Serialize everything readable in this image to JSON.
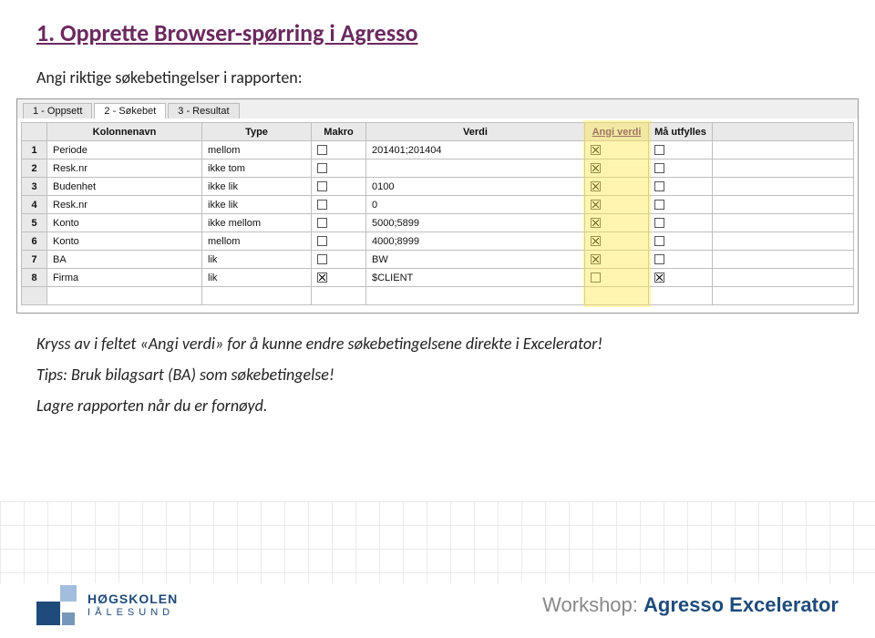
{
  "title": "1. Opprette Browser-spørring i Agresso",
  "intro": "Angi riktige søkebetingelser i rapporten:",
  "tabs": {
    "t1": "1 - Oppsett",
    "t2": "2 - Søkebet",
    "t3": "3 - Resultat"
  },
  "headers": {
    "kol": "Kolonnenavn",
    "type": "Type",
    "makro": "Makro",
    "verdi": "Verdi",
    "angi": "Angi verdi",
    "maa": "Må utfylles"
  },
  "rows": [
    {
      "n": "1",
      "name": "Periode",
      "type": "mellom",
      "makro": false,
      "verdi": "201401;201404",
      "angi": true,
      "maa": false
    },
    {
      "n": "2",
      "name": "Resk.nr",
      "type": "ikke tom",
      "makro": false,
      "verdi": "",
      "angi": true,
      "maa": false
    },
    {
      "n": "3",
      "name": "Budenhet",
      "type": "ikke lik",
      "makro": false,
      "verdi": "0100",
      "angi": true,
      "maa": false
    },
    {
      "n": "4",
      "name": "Resk.nr",
      "type": "ikke lik",
      "makro": false,
      "verdi": "0",
      "angi": true,
      "maa": false
    },
    {
      "n": "5",
      "name": "Konto",
      "type": "ikke mellom",
      "makro": false,
      "verdi": "5000;5899",
      "angi": true,
      "maa": false
    },
    {
      "n": "6",
      "name": "Konto",
      "type": "mellom",
      "makro": false,
      "verdi": "4000;8999",
      "angi": true,
      "maa": false
    },
    {
      "n": "7",
      "name": "BA",
      "type": "lik",
      "makro": false,
      "verdi": "BW",
      "angi": true,
      "maa": false
    },
    {
      "n": "8",
      "name": "Firma",
      "type": "lik",
      "makro": true,
      "verdi": "$CLIENT",
      "angi": false,
      "maa": true
    }
  ],
  "note1": "Kryss av i feltet «Angi verdi» for å kunne endre søkebetingelsene direkte i Excelerator!",
  "note2": "Tips: Bruk bilagsart (BA) som søkebetingelse!",
  "note3": "Lagre rapporten når du er fornøyd.",
  "logo": {
    "line1": "HØGSKOLEN",
    "line2_pre": "I ",
    "line2_spaced": "ÅLESUND"
  },
  "footer": {
    "workshop": "Workshop: ",
    "product": "Agresso Excelerator"
  }
}
